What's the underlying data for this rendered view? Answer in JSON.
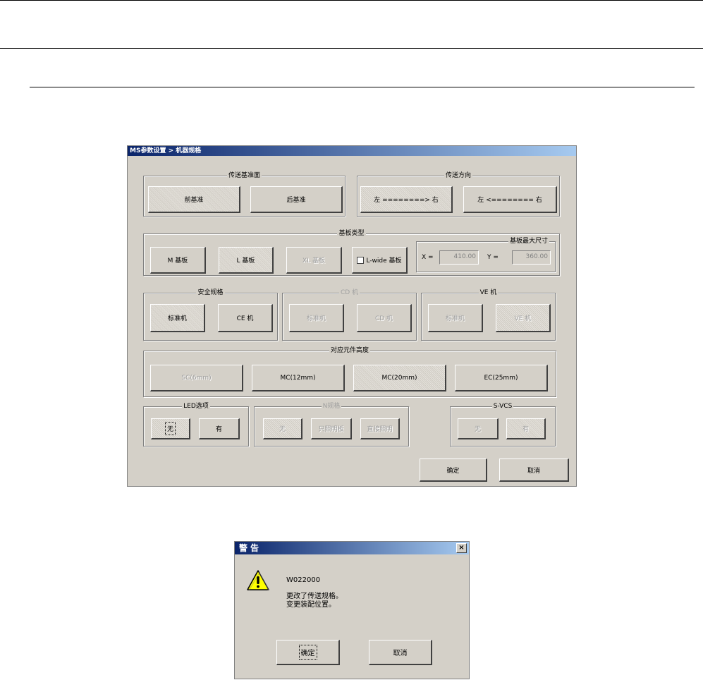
{
  "main_window": {
    "title": "MS参数设置 > 机器规格",
    "transfer_ref_group": {
      "label": "传送基准面",
      "front": "前基准",
      "rear": "后基准"
    },
    "transfer_dir_group": {
      "label": "传送方向",
      "ltr": "左 ========> 右",
      "rtl": "左 <======== 右"
    },
    "board_type_group": {
      "label": "基板类型",
      "m": "M 基板",
      "l": "L 基板",
      "xl": "XL 基板",
      "lwide": "L-wide 基板"
    },
    "board_max_group": {
      "label": "基板最大尺寸",
      "x_label": "X =",
      "x_value": "410.00",
      "y_label": "Y =",
      "y_value": "360.00"
    },
    "safety_group": {
      "label": "安全规格",
      "standard": "标准机",
      "ce": "CE 机"
    },
    "cd_group": {
      "label": "CD 机",
      "standard": "标准机",
      "cd": "CD 机"
    },
    "ve_group": {
      "label": "VE 机",
      "standard": "标准机",
      "ve": "VE 机"
    },
    "height_group": {
      "label": "对应元件高度",
      "sc": "SC(6mm)",
      "mc12": "MC(12mm)",
      "mc20": "MC(20mm)",
      "ec": "EC(25mm)"
    },
    "led_group": {
      "label": "LED选项",
      "none": "无",
      "yes": "有"
    },
    "n_group": {
      "label": "N规格",
      "none": "无",
      "a": "只照明板",
      "b": "直接照明"
    },
    "svcs_group": {
      "label": "S-VCS",
      "none": "无",
      "yes": "有"
    },
    "ok": "确定",
    "cancel": "取消"
  },
  "warning_dialog": {
    "title": "警告",
    "close": "×",
    "code": "W022000",
    "line1": "更改了传送规格。",
    "line2": "变更装配位置。",
    "ok": "确定",
    "cancel": "取消",
    "icon": "warning-triangle-icon"
  }
}
